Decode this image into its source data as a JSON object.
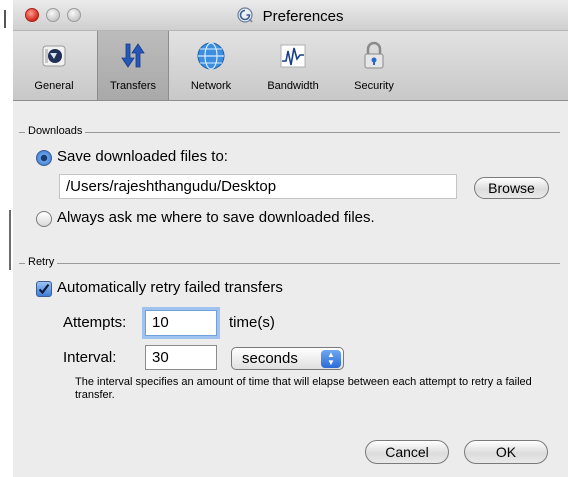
{
  "window": {
    "title": "Preferences"
  },
  "toolbar": {
    "items": [
      {
        "label": "General",
        "icon": "general-icon"
      },
      {
        "label": "Transfers",
        "icon": "transfers-icon",
        "selected": true
      },
      {
        "label": "Network",
        "icon": "network-icon"
      },
      {
        "label": "Bandwidth",
        "icon": "bandwidth-icon"
      },
      {
        "label": "Security",
        "icon": "security-icon"
      }
    ]
  },
  "downloads": {
    "group_label": "Downloads",
    "save_to_label": "Save downloaded files to:",
    "path": "/Users/rajeshthangudu/Desktop",
    "browse_label": "Browse",
    "always_ask_label": "Always ask me where to save downloaded files.",
    "selected_option": "save_to"
  },
  "retry": {
    "group_label": "Retry",
    "auto_retry_label": "Automatically retry failed transfers",
    "auto_retry_checked": true,
    "attempts_label": "Attempts:",
    "attempts_value": "10",
    "attempts_unit": "time(s)",
    "interval_label": "Interval:",
    "interval_value": "30",
    "interval_unit": "seconds",
    "note": "The interval specifies an amount of time that will elapse between each attempt to retry a failed transfer."
  },
  "buttons": {
    "cancel": "Cancel",
    "ok": "OK"
  },
  "colors": {
    "accent": "#3c7ad6",
    "close": "#d32a1c"
  }
}
